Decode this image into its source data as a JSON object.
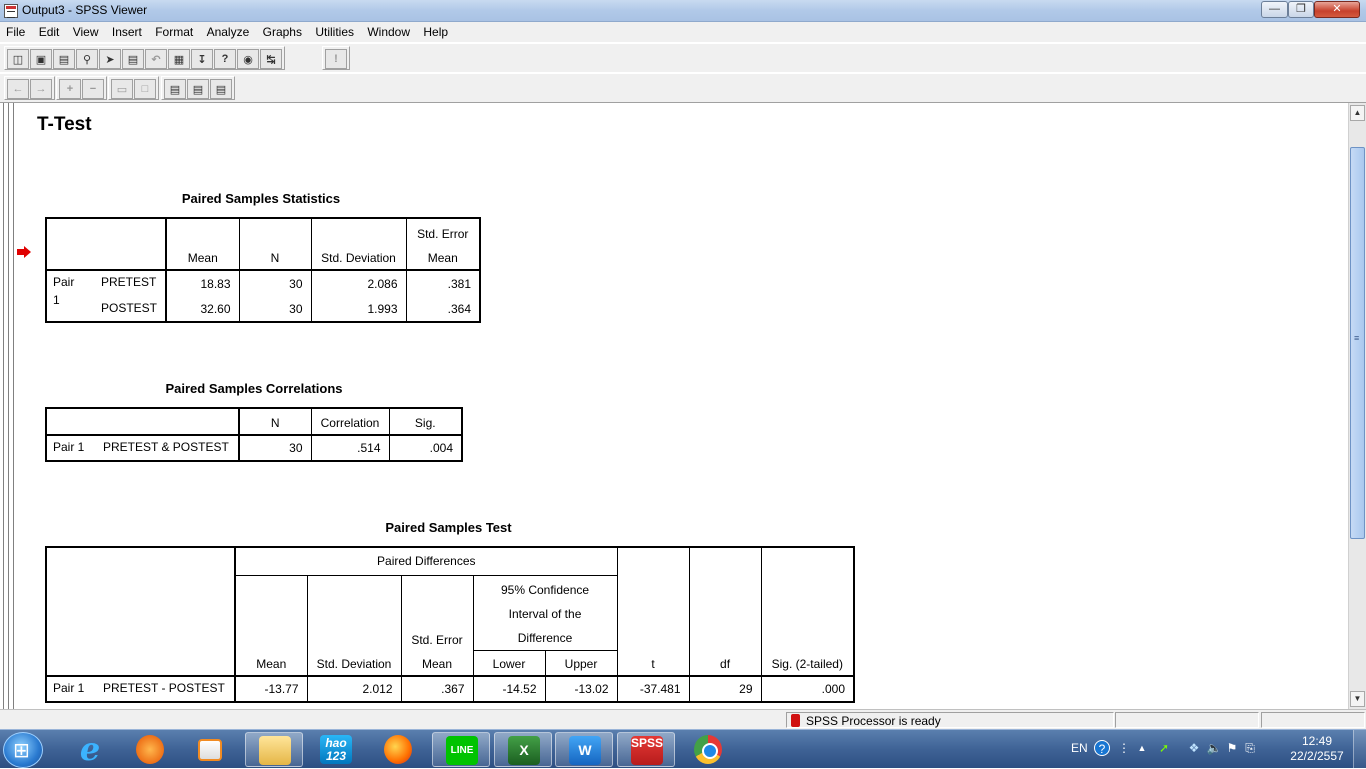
{
  "window": {
    "title": "Output3 - SPSS Viewer"
  },
  "menu": [
    "File",
    "Edit",
    "View",
    "Insert",
    "Format",
    "Analyze",
    "Graphs",
    "Utilities",
    "Window",
    "Help"
  ],
  "output": {
    "heading": "T-Test",
    "stats": {
      "title": "Paired Samples Statistics",
      "col_mean": "Mean",
      "col_n": "N",
      "col_sd": "Std. Deviation",
      "col_se_line1": "Std. Error",
      "col_se_line2": "Mean",
      "pair_label_1": "Pair",
      "pair_label_2": "1",
      "rows": [
        {
          "var": "PRETEST",
          "mean": "18.83",
          "n": "30",
          "sd": "2.086",
          "se": ".381"
        },
        {
          "var": "POSTEST",
          "mean": "32.60",
          "n": "30",
          "sd": "1.993",
          "se": ".364"
        }
      ]
    },
    "corr": {
      "title": "Paired Samples Correlations",
      "col_n": "N",
      "col_corr": "Correlation",
      "col_sig": "Sig.",
      "pair": "Pair 1",
      "var": "PRETEST & POSTEST",
      "n": "30",
      "corr": ".514",
      "sig": ".004"
    },
    "test": {
      "title": "Paired Samples Test",
      "group_header": "Paired Differences",
      "ci_header_1": "95% Confidence",
      "ci_header_2": "Interval of the",
      "ci_header_3": "Difference",
      "col_mean": "Mean",
      "col_sd": "Std. Deviation",
      "col_se_1": "Std. Error",
      "col_se_2": "Mean",
      "col_lower": "Lower",
      "col_upper": "Upper",
      "col_t": "t",
      "col_df": "df",
      "col_sig": "Sig. (2-tailed)",
      "pair": "Pair 1",
      "var": "PRETEST - POSTEST",
      "mean": "-13.77",
      "sd": "2.012",
      "se": ".367",
      "lower": "-14.52",
      "upper": "-13.02",
      "t": "-37.481",
      "df": "29",
      "sig": ".000"
    }
  },
  "status": {
    "message": "SPSS Processor  is ready"
  },
  "taskbar": {
    "hao_label": "hao\n123",
    "line_label": "LINE",
    "spss_label": "SPSS",
    "lang": "EN",
    "time": "12:49",
    "date": "22/2/2557"
  },
  "colors": {
    "titlebar": "#b1c9e8",
    "close": "#c7412c",
    "arrow": "#e00000",
    "taskbar": "#3f6396"
  },
  "icons": {
    "toolbar1": [
      "open-icon",
      "save-icon",
      "print-icon",
      "print-preview-icon",
      "export-icon",
      "recall-dialog-icon",
      "undo-icon",
      "goto-data-icon",
      "goto-case-icon",
      "variables-icon",
      "use-sets-icon",
      "select-last-output-icon",
      "designate-window-icon"
    ],
    "toolbar2": [
      "promote-icon",
      "demote-icon",
      "expand-icon",
      "collapse-icon",
      "show-icon",
      "hide-icon",
      "insert-heading-icon",
      "insert-title-icon",
      "insert-text-icon"
    ]
  }
}
